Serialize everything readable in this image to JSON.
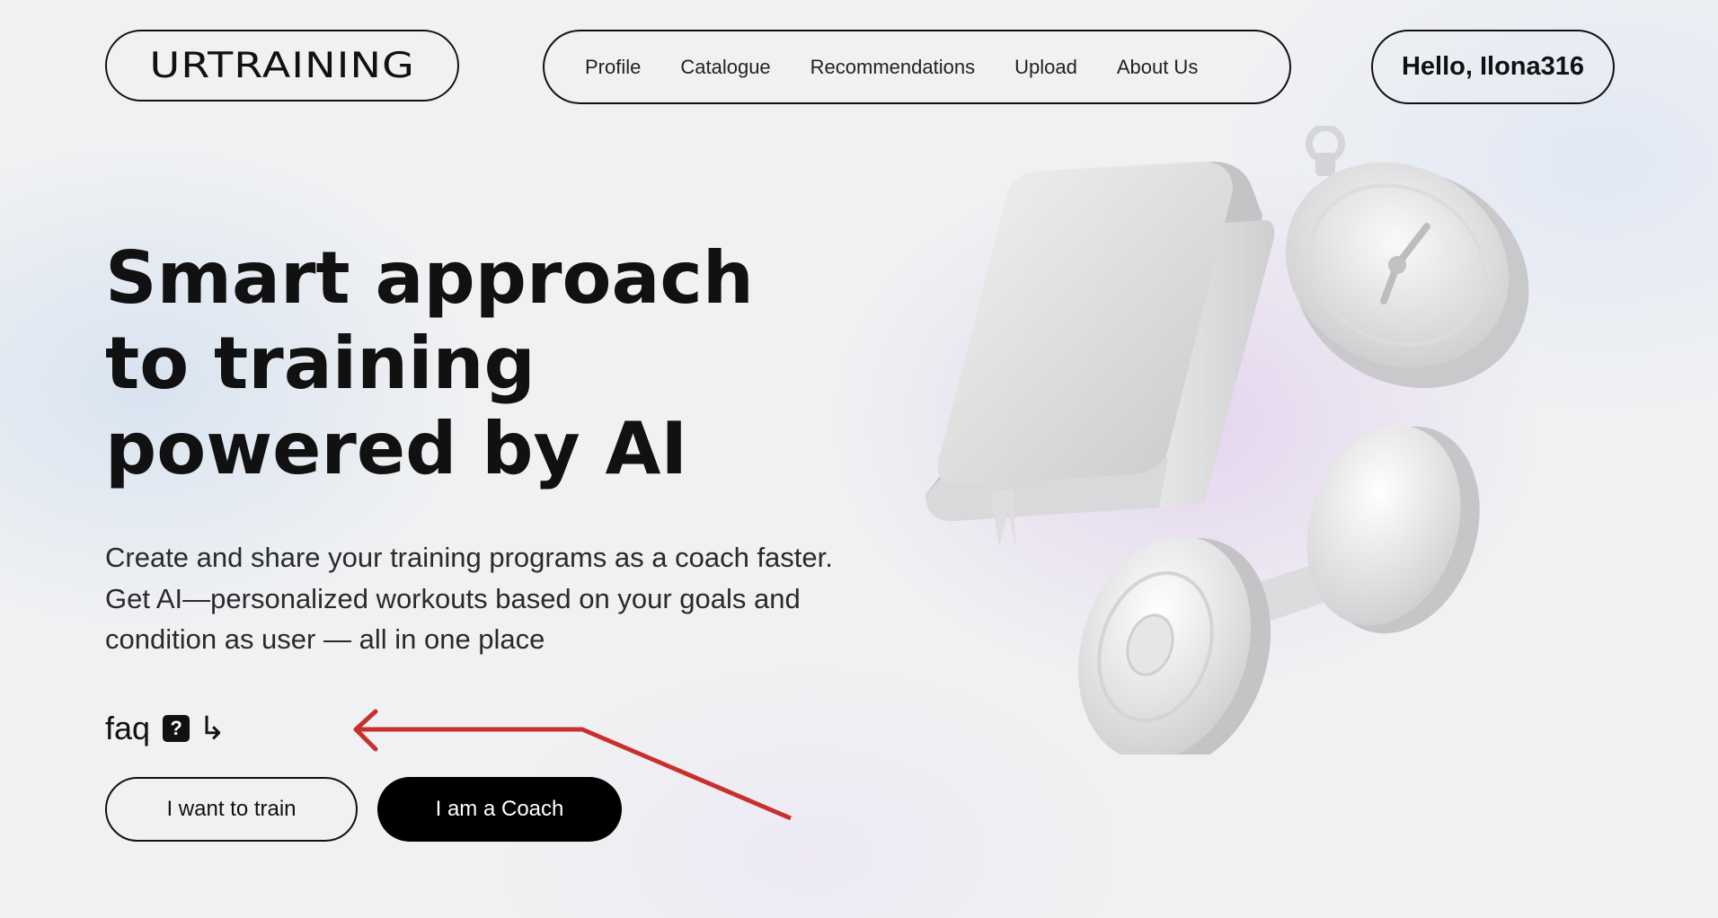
{
  "header": {
    "logo": "URTRAINING",
    "nav": [
      {
        "label": "Profile"
      },
      {
        "label": "Catalogue"
      },
      {
        "label": "Recommendations"
      },
      {
        "label": "Upload"
      },
      {
        "label": "About Us"
      }
    ],
    "greeting": "Hello, Ilona316"
  },
  "hero": {
    "headline_lines": [
      "Smart approach",
      "to training",
      "powered by AI"
    ],
    "description": "Create and share your training programs as a coach faster. Get AI—personalized workouts based on your goals and condition as user — all in one place",
    "faq": {
      "label": "faq",
      "q_glyph": "?",
      "arrow_glyph": "↳"
    },
    "buttons": {
      "train": "I want to train",
      "coach": "I am a Coach"
    }
  },
  "illustration": {
    "icons": [
      "book-icon",
      "stopwatch-icon",
      "dumbbell-icon"
    ]
  },
  "colors": {
    "text": "#111111",
    "coach_button_bg": "#000000",
    "annotation_arrow": "#c8302c"
  }
}
